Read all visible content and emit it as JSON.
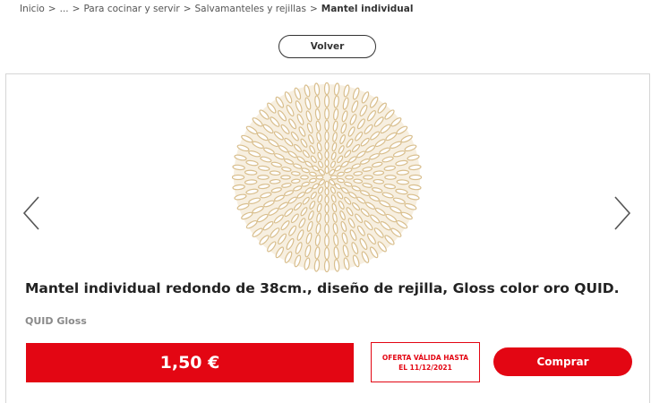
{
  "breadcrumb": {
    "items": [
      "Inicio",
      "...",
      "Para cocinar y servir",
      "Salvamanteles y rejillas"
    ],
    "separator": ">",
    "current": "Mantel individual"
  },
  "back_button": {
    "label": "Volver"
  },
  "product": {
    "image_icon": "placemat-image",
    "title": "Mantel individual redondo de 38cm., diseño de rejilla, Gloss color oro QUID.",
    "brand": "QUID Gloss",
    "price": "1,50 €",
    "offer": {
      "line1": "OFERTA VÁLIDA HASTA",
      "line2": "EL 11/12/2021"
    },
    "buy_label": "Comprar"
  },
  "carousel": {
    "prev_icon": "chevron-left-icon",
    "next_icon": "chevron-right-icon"
  },
  "colors": {
    "accent": "#e30613",
    "text": "#222222",
    "muted": "#8a8a8a",
    "border": "#d6d6d6"
  }
}
